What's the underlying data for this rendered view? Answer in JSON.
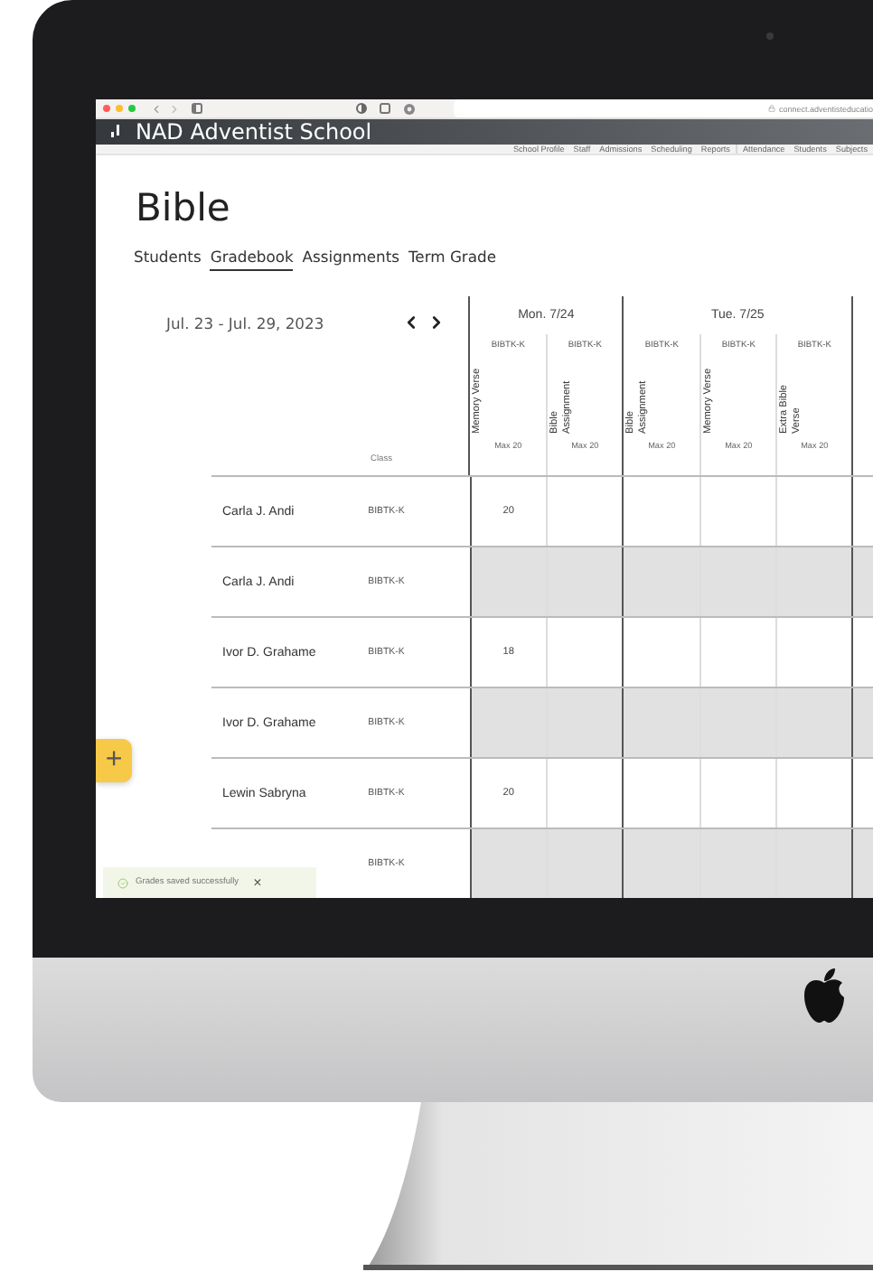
{
  "browser": {
    "url": "connect.adventisteducatio"
  },
  "header": {
    "title": "NAD Adventist School"
  },
  "nav_groups": [
    [
      "School Profile",
      "Staff",
      "Admissions",
      "Scheduling",
      "Reports"
    ],
    [
      "Attendance",
      "Students",
      "Subjects"
    ]
  ],
  "page": {
    "title": "Bible",
    "tabs": [
      {
        "label": "Students",
        "selected": false
      },
      {
        "label": "Gradebook",
        "selected": true
      },
      {
        "label": "Assignments",
        "selected": false
      },
      {
        "label": "Term Grade",
        "selected": false
      }
    ]
  },
  "gradebook": {
    "date_range": "Jul. 23 - Jul. 29, 2023",
    "class_header": "Class",
    "days": [
      {
        "label": "Mon. 7/24",
        "assignments": [
          {
            "class": "BIBTK-K",
            "title": "Memory Verse",
            "max": "Max 20"
          },
          {
            "class": "BIBTK-K",
            "title": "Bible Assignment",
            "max": "Max 20"
          }
        ]
      },
      {
        "label": "Tue. 7/25",
        "assignments": [
          {
            "class": "BIBTK-K",
            "title": "Bible Assignment",
            "max": "Max 20"
          },
          {
            "class": "BIBTK-K",
            "title": "Memory Verse",
            "max": "Max 20"
          },
          {
            "class": "BIBTK-K",
            "title": "Extra Bible Verse",
            "max": "Max 20"
          }
        ]
      }
    ],
    "rows": [
      {
        "name": "Carla J. Andi",
        "class": "BIBTK-K",
        "disabled": false,
        "grade": "20"
      },
      {
        "name": "Carla J. Andi",
        "class": "BIBTK-K",
        "disabled": true
      },
      {
        "name": "Ivor D. Grahame",
        "class": "BIBTK-K",
        "disabled": false,
        "grade": "18"
      },
      {
        "name": "Ivor D. Grahame",
        "class": "BIBTK-K",
        "disabled": true
      },
      {
        "name": "Lewin Sabryna",
        "class": "BIBTK-K",
        "disabled": false,
        "grade": "20"
      },
      {
        "class": "BIBTK-K",
        "disabled": true
      }
    ]
  },
  "toast": {
    "message": "Grades saved successfully",
    "close": "×"
  },
  "add_button": {
    "label": "+"
  }
}
